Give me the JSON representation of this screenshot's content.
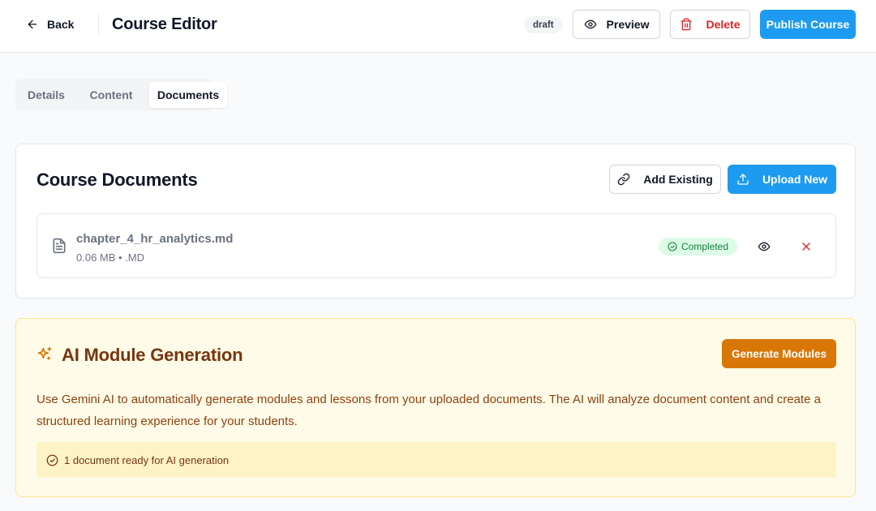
{
  "header": {
    "back_label": "Back",
    "title": "Course Editor",
    "status_badge": "draft",
    "preview_label": "Preview",
    "delete_label": "Delete",
    "publish_label": "Publish Course"
  },
  "tabs": [
    {
      "label": "Details",
      "active": false
    },
    {
      "label": "Content",
      "active": false
    },
    {
      "label": "Documents",
      "active": true
    }
  ],
  "documents": {
    "title": "Course Documents",
    "add_existing_label": "Add Existing",
    "upload_new_label": "Upload New",
    "items": [
      {
        "name": "chapter_4_hr_analytics.md",
        "meta": "0.06 MB • .MD",
        "status": "Completed",
        "icon": "file-text-icon"
      }
    ]
  },
  "ai": {
    "title": "AI Module Generation",
    "generate_label": "Generate Modules",
    "description": "Use Gemini AI to automatically generate modules and lessons from your uploaded documents. The AI will analyze document content and create a structured learning experience for your students.",
    "ready_note": "1 document ready for AI generation"
  },
  "colors": {
    "primary": "#1d9bf0",
    "danger": "#dc2626",
    "success_bg": "#dcfce7",
    "success_text": "#15803d",
    "ai_accent": "#d97706",
    "ai_bg": "#fefce8"
  }
}
